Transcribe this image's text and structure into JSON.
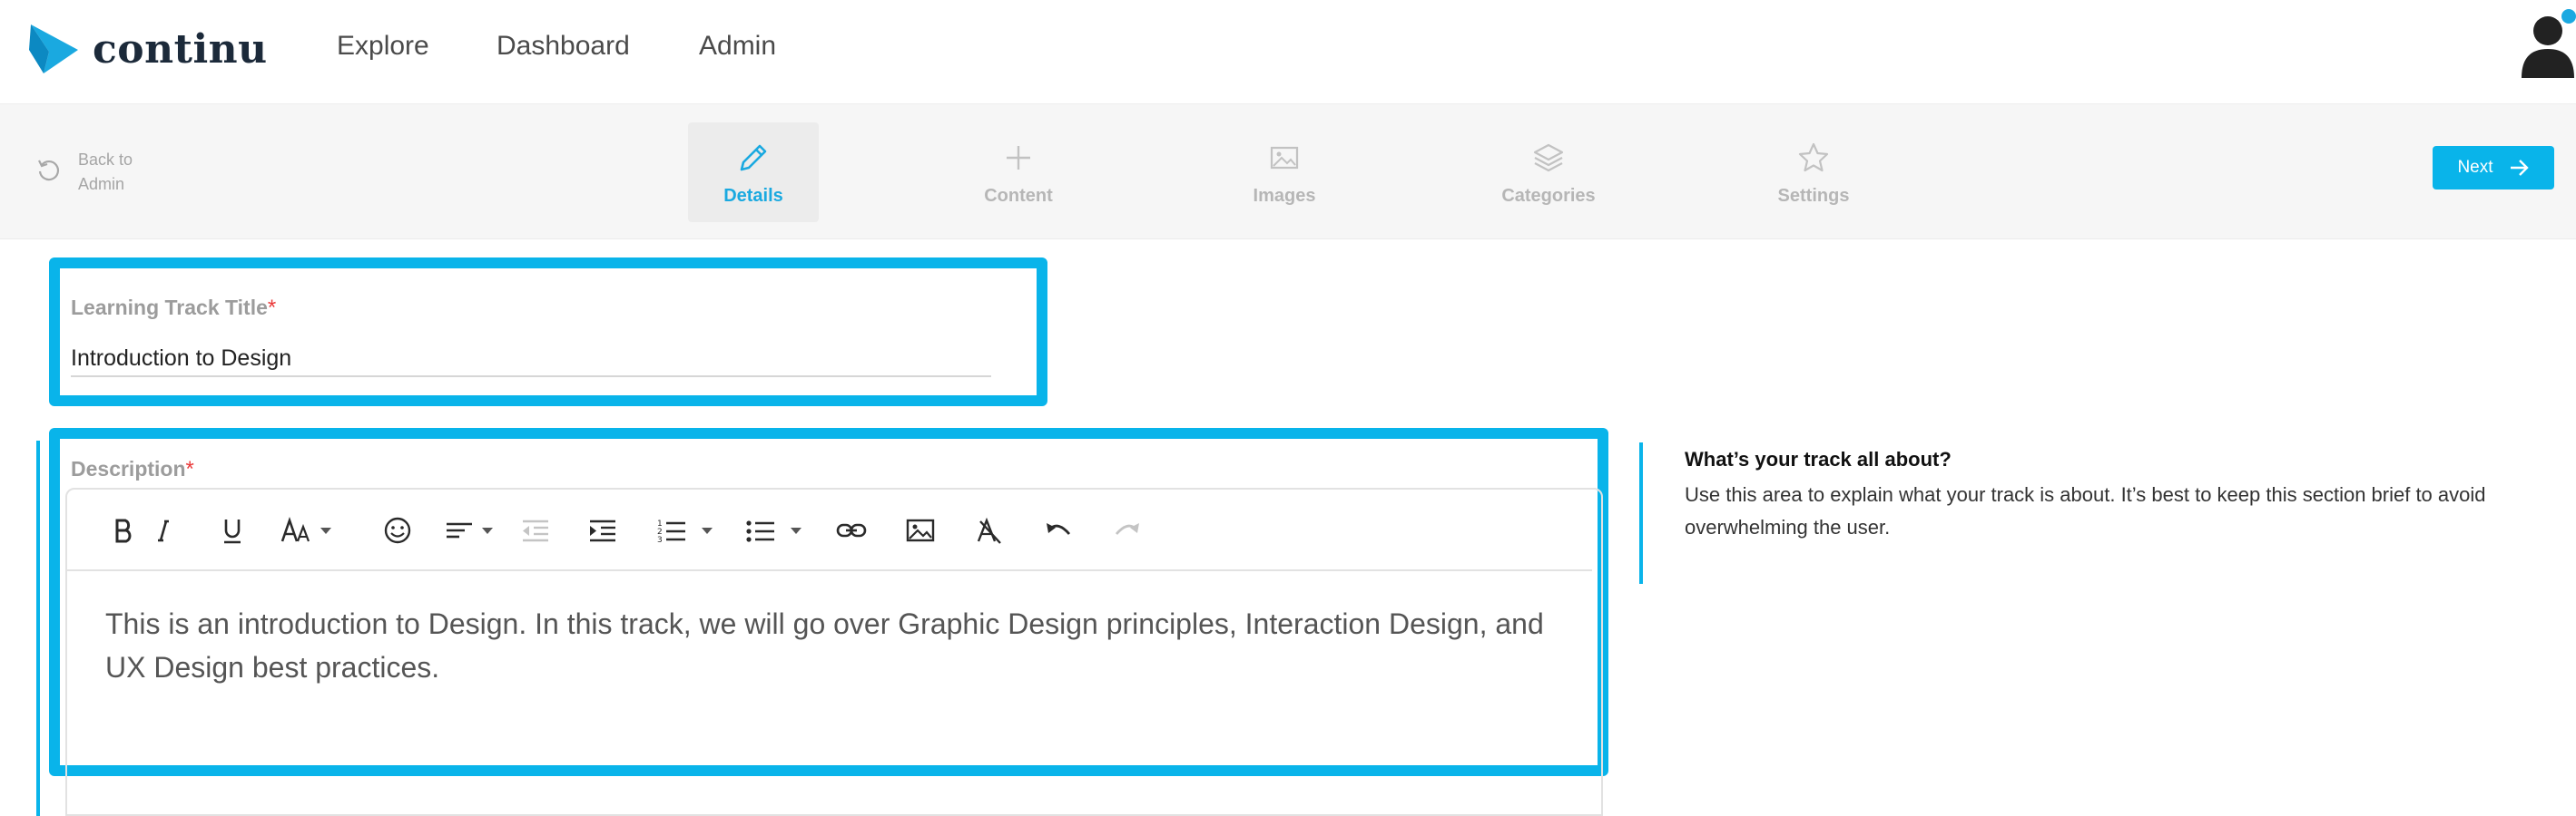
{
  "brand": {
    "name": "continu",
    "accent": "#09b4ea",
    "dark": "#1c2a3a"
  },
  "nav": {
    "links": [
      {
        "label": "Explore"
      },
      {
        "label": "Dashboard"
      },
      {
        "label": "Admin"
      }
    ],
    "avatar_icon": "user-avatar-icon"
  },
  "toolbar": {
    "back_label": "Back to Admin",
    "back_icon": "undo-circle-icon",
    "steps": [
      {
        "label": "Details",
        "icon": "pencil-icon",
        "active": true
      },
      {
        "label": "Content",
        "icon": "plus-icon",
        "active": false
      },
      {
        "label": "Images",
        "icon": "image-icon",
        "active": false
      },
      {
        "label": "Categories",
        "icon": "layers-icon",
        "active": false
      },
      {
        "label": "Settings",
        "icon": "star-icon",
        "active": false
      }
    ],
    "next_label": "Next",
    "next_icon": "arrow-right-icon"
  },
  "form": {
    "title_field": {
      "label": "Learning Track Title",
      "required_mark": "*",
      "value": "Introduction to Design"
    },
    "description_field": {
      "label": "Description",
      "required_mark": "*",
      "content": "This is an introduction to Design. In this track, we will go over Graphic Design principles, Interaction Design, and UX Design best practices."
    },
    "editor_tools": [
      "bold-icon",
      "italic-icon",
      "underline-icon",
      "font-size-icon",
      "emoji-icon",
      "align-icon",
      "outdent-icon",
      "indent-icon",
      "ordered-list-icon",
      "bullet-list-icon",
      "link-icon",
      "insert-image-icon",
      "clear-format-icon",
      "undo-icon",
      "redo-icon"
    ]
  },
  "help": {
    "title": "What’s your track all about?",
    "body": "Use this area to explain what your track is about. It’s best to keep this section brief to avoid overwhelming the user."
  }
}
